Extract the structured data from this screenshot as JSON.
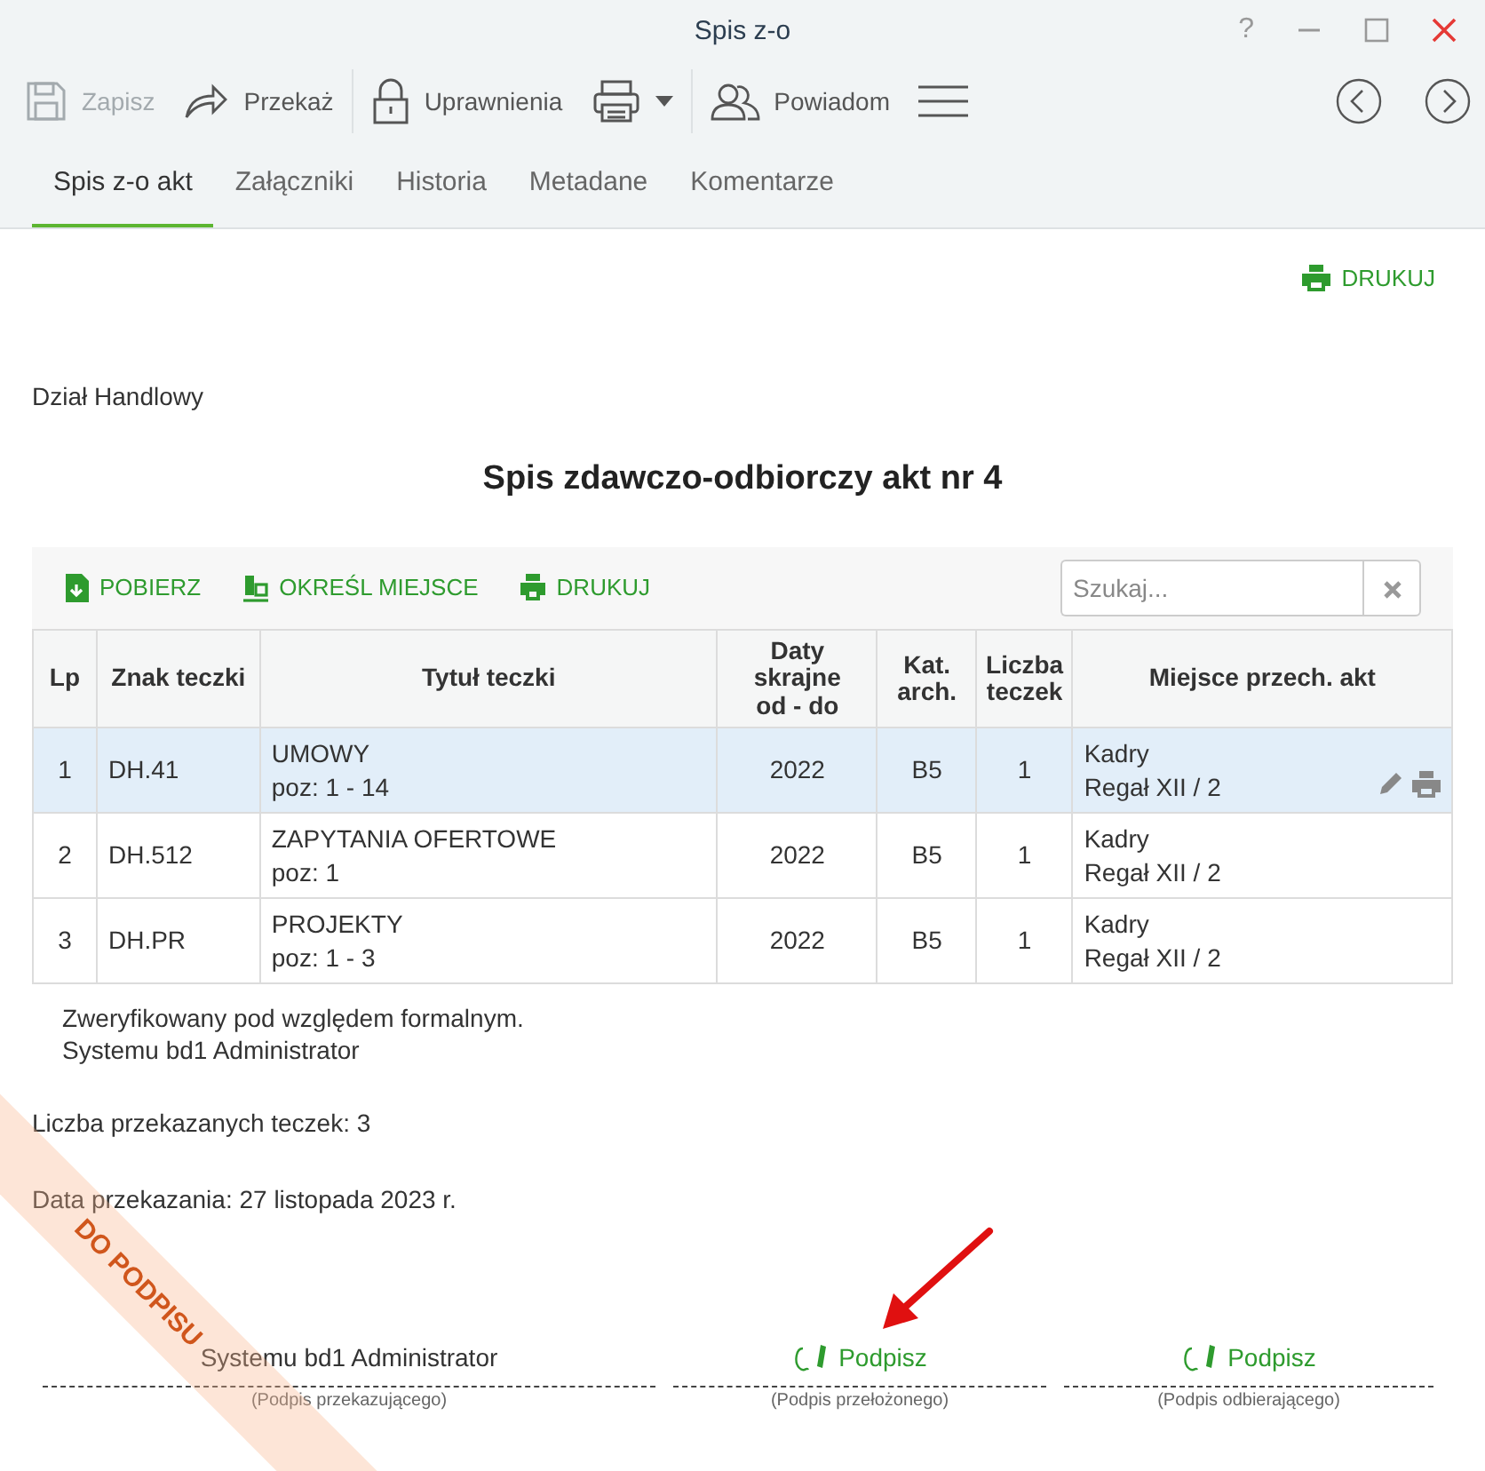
{
  "window": {
    "title": "Spis z-o",
    "controls": [
      "?"
    ]
  },
  "toolbar": [
    {
      "kind": "save",
      "label": "Zapisz",
      "disabled": true
    },
    {
      "kind": "forward",
      "label": "Przekaż",
      "disabled": false
    },
    {
      "kind": "lock",
      "label": "Uprawnienia",
      "disabled": false
    },
    {
      "kind": "print",
      "disabled": false
    },
    {
      "kind": "people",
      "label": "Powiadom",
      "disabled": false
    },
    {
      "kind": "menu",
      "disabled": false
    }
  ],
  "tabs": [
    {
      "label": "Spis z-o akt",
      "selected": true
    },
    {
      "label": "Załączniki",
      "selected": false
    },
    {
      "label": "Historia",
      "selected": false
    },
    {
      "label": "Metadane",
      "selected": false
    },
    {
      "label": "Komentarze",
      "selected": false
    }
  ],
  "print_link": "DRUKUJ",
  "department": "Dział Handlowy",
  "heading": "Spis zdawczo-odbiorczy akt nr 4",
  "table_actions": [
    {
      "kind": "download",
      "label": "POBIERZ"
    },
    {
      "kind": "place",
      "label": "OKREŚL MIEJSCE"
    },
    {
      "kind": "print",
      "label": "DRUKUJ"
    }
  ],
  "search": {
    "placeholder": "Szukaj..."
  },
  "table": {
    "columns": [
      "Lp",
      "Znak teczki",
      "Tytuł teczki",
      "Daty skrajne od - do",
      "Kat. arch.",
      "Liczba teczek",
      "Miejsce przech. akt"
    ],
    "rows": [
      {
        "selected": true,
        "cells": [
          "1",
          "DH.41",
          [
            "UMOWY",
            "poz: 1 - 14"
          ],
          "2022",
          "B5",
          "1",
          [
            "Kadry",
            "Regał XII / 2"
          ]
        ]
      },
      {
        "selected": false,
        "cells": [
          "2",
          "DH.512",
          [
            "ZAPYTANIA OFERTOWE",
            "poz: 1"
          ],
          "2022",
          "B5",
          "1",
          [
            "Kadry",
            "Regał XII / 2"
          ]
        ]
      },
      {
        "selected": false,
        "cells": [
          "3",
          "DH.PR",
          [
            "PROJEKTY",
            "poz: 1 - 3"
          ],
          "2022",
          "B5",
          "1",
          [
            "Kadry",
            "Regał XII / 2"
          ]
        ]
      }
    ]
  },
  "verification": [
    "Zweryfikowany pod względem formalnym.",
    "Systemu bd1 Administrator"
  ],
  "count_text": "Liczba przekazanych teczek: 3",
  "date_text": "Data przekazania: 27 listopada 2023 r.",
  "signatures": [
    {
      "kind": "signed",
      "text": "Systemu bd1 Administrator",
      "caption": "(Podpis przekazującego)"
    },
    {
      "kind": "sign",
      "text": "Podpisz",
      "caption": "(Podpis przełożonego)"
    },
    {
      "kind": "sign",
      "text": "Podpisz",
      "caption": "(Podpis odbierającego)"
    }
  ],
  "stamp": "DO PODPISU"
}
